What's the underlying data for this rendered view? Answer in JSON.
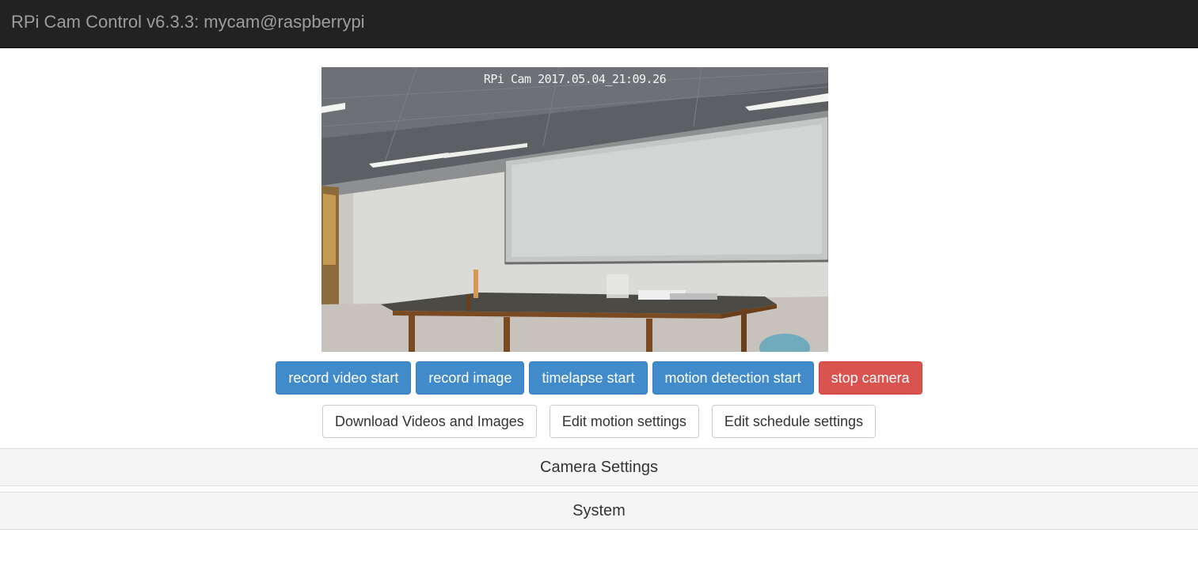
{
  "header": {
    "title": "RPi Cam Control v6.3.3: mycam@raspberrypi"
  },
  "preview": {
    "overlay_text": "RPi Cam 2017.05.04_21:09.26"
  },
  "controls": {
    "record_video": "record video start",
    "record_image": "record image",
    "timelapse": "timelapse start",
    "motion_detection": "motion detection start",
    "stop_camera": "stop camera"
  },
  "links": {
    "download": "Download Videos and Images",
    "edit_motion": "Edit motion settings",
    "edit_schedule": "Edit schedule settings"
  },
  "panels": {
    "camera_settings": "Camera Settings",
    "system": "System"
  },
  "colors": {
    "navbar": "#222222",
    "primary": "#428bca",
    "danger": "#d9534f"
  }
}
